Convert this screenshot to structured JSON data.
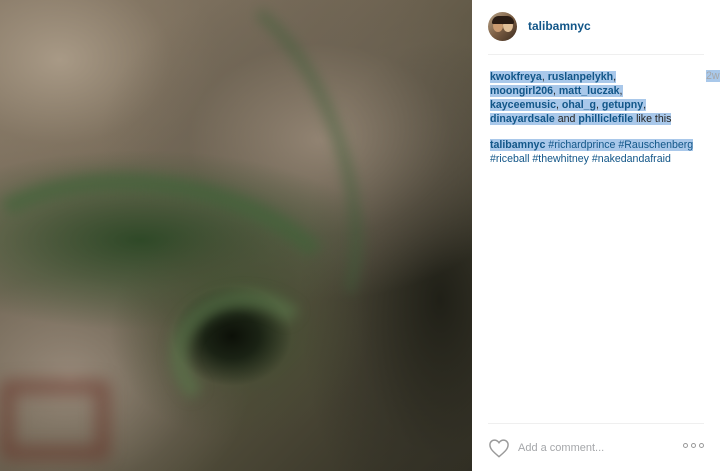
{
  "post": {
    "username": "talibamnyc",
    "time_ago": "2w",
    "likes": {
      "users": [
        "kwokfreya",
        "ruslanpelykh",
        "moongirl206",
        "matt_luczak",
        "kayceemusic",
        "ohal_g",
        "getupny",
        "dinayardsale"
      ],
      "last_user": "philliclefile",
      "and_word": "and",
      "suffix": "like this"
    },
    "caption": {
      "author": "talibamnyc",
      "hashtags": [
        "#richardprince",
        "#Rauschenberg",
        "#riceball",
        "#thewhitney",
        "#nakedandafraid"
      ]
    }
  },
  "footer": {
    "comment_placeholder": "Add a comment...",
    "like_icon": "heart-icon",
    "more_icon": "more-options-icon"
  },
  "colors": {
    "link": "#125688",
    "muted": "#a5a7aa",
    "selection": "#a9c8ea"
  }
}
